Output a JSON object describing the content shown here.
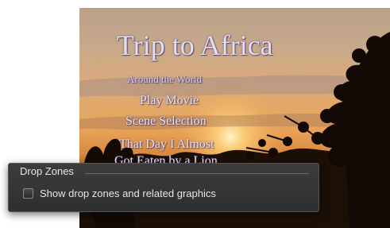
{
  "menu_preview": {
    "title": "Trip to Africa",
    "subtitle": "Around the World",
    "buttons": [
      "Play Movie",
      "Scene Selection",
      "That Day I Almost",
      "Got Eaten by a Lion"
    ]
  },
  "drop_zones_panel": {
    "header": "Drop Zones",
    "checkbox": {
      "label": "Show drop zones and related graphics",
      "checked": false
    }
  },
  "colors": {
    "panel_bg": "#333333",
    "panel_text": "#e6e6e6",
    "menu_text": "#e9e4f2"
  }
}
